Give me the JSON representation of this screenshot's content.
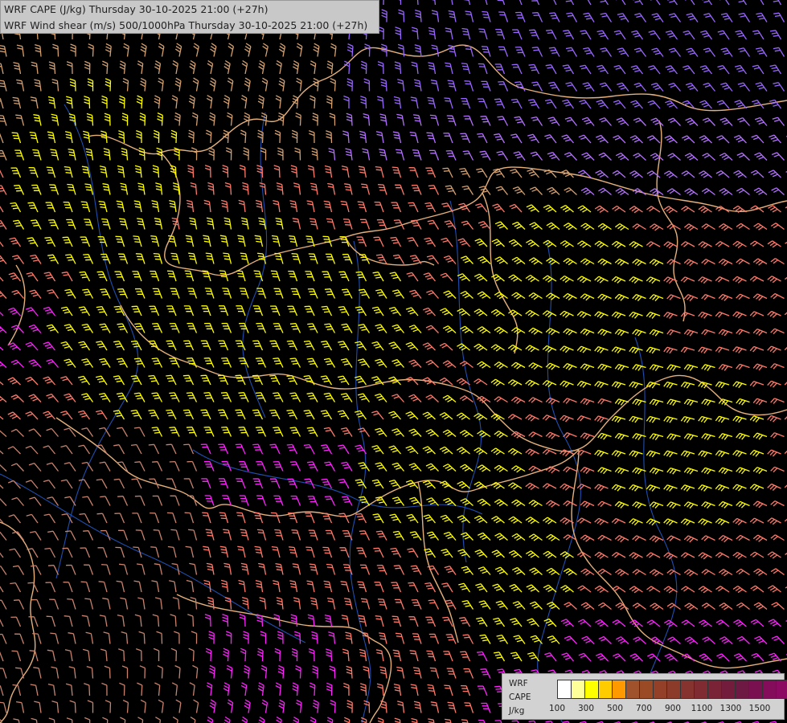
{
  "title": {
    "line1": "WRF CAPE (J/kg) Thursday 30-10-2025 21:00 (+27h)",
    "line2": "WRF Wind shear (m/s) 500/1000hPa Thursday 30-10-2025 21:00 (+27h)"
  },
  "legend": {
    "label_lines": [
      "WRF",
      "CAPE",
      "J/kg"
    ],
    "swatches": [
      "#ffffff",
      "#ffff9a",
      "#ffff00",
      "#ffcc00",
      "#ff9900",
      "#a0522d",
      "#9a4a24",
      "#944028",
      "#8c3a2a",
      "#86322e",
      "#802a32",
      "#7a2236",
      "#741c3c",
      "#6e1844",
      "#7a1050",
      "#840c5a",
      "#8c0a62"
    ],
    "ticks": [
      "100",
      "300",
      "500",
      "700",
      "900",
      "1100",
      "1300",
      "1500"
    ]
  },
  "colors": {
    "background": "#000000",
    "borders": "#e6b07a",
    "rivers": "#1f4fb0",
    "barb_purple": "#9966ff",
    "barb_violet": "#b470ff",
    "barb_tan": "#d4a070",
    "barb_yellow": "#ffff00",
    "barb_salmon": "#ff7a6a",
    "barb_magenta": "#ff22ff",
    "barb_brown": "#c8826e"
  }
}
